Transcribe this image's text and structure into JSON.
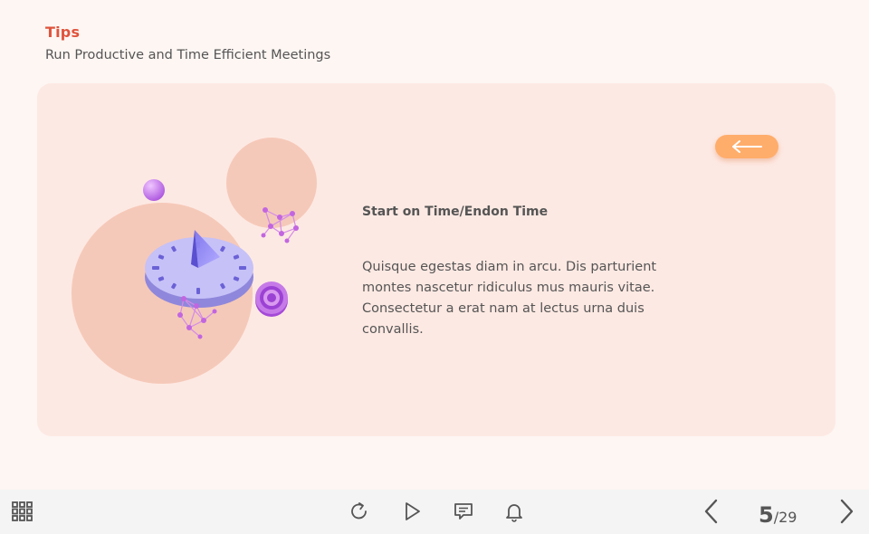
{
  "header": {
    "title": "Tips",
    "subtitle": "Run Productive and Time Efficient Meetings"
  },
  "content": {
    "heading": "Start on Time/Endon Time",
    "body": "Quisque egestas diam in arcu. Dis parturient montes nascetur ridiculus mus mauris vitae. Consectetur a erat nam at lectus urna duis convallis.",
    "back_button_icon": "arrow-left-icon"
  },
  "toolbar": {
    "menu_icon": "grid-menu-icon",
    "replay_icon": "replay-icon",
    "play_icon": "play-icon",
    "comments_icon": "comment-icon",
    "notifications_icon": "bell-icon",
    "prev_icon": "chevron-left-icon",
    "next_icon": "chevron-right-icon",
    "current_page": "5",
    "total_pages": "/29"
  },
  "colors": {
    "accent": "#e0533b",
    "card_background": "#fde9e3",
    "circle": "#f5c9b9",
    "button": "#ffad6b",
    "clock": "#b8b2f2",
    "spheres": "#a855d4"
  }
}
